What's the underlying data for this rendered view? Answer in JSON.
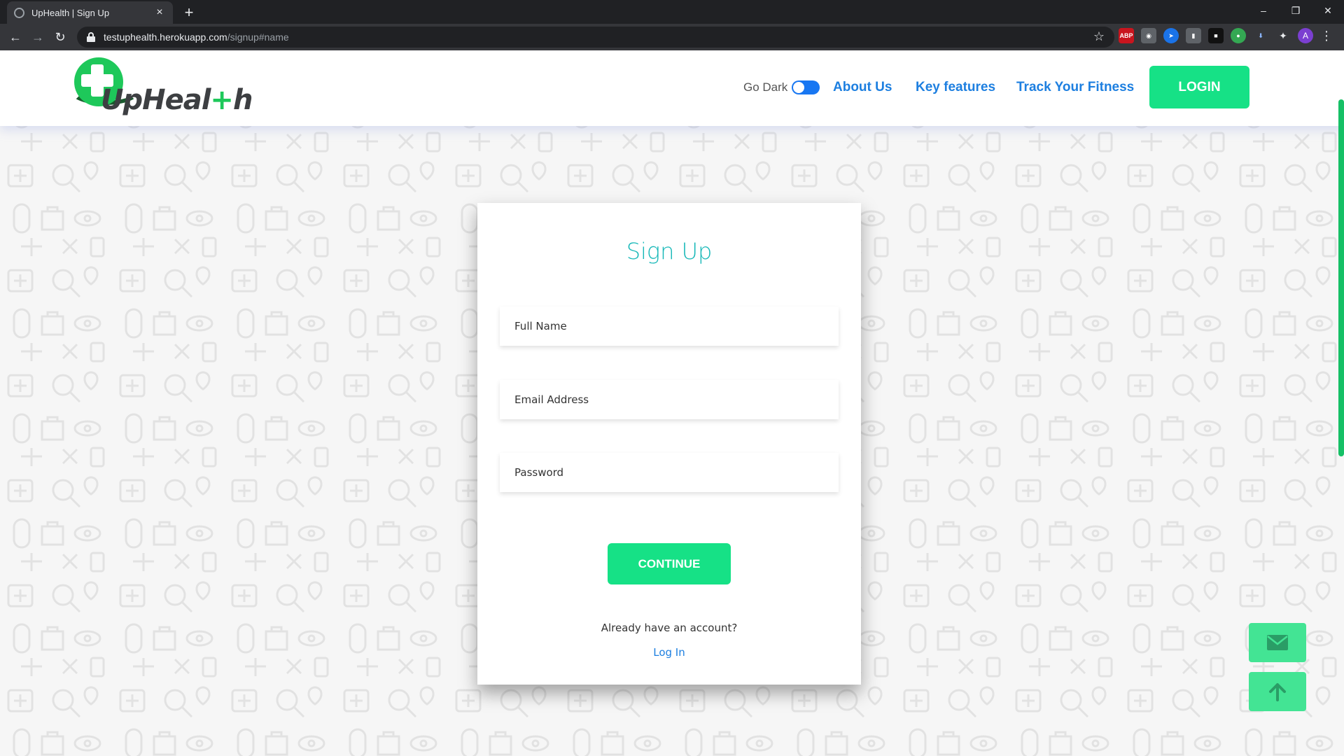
{
  "browser": {
    "tab_title": "UpHealth | Sign Up",
    "tab_close": "×",
    "new_tab": "+",
    "url_host": "testuphealth.herokuapp.com",
    "url_path": "/signup#name",
    "avatar_letter": "A",
    "ext_abp": "ABP",
    "window_minimize": "–",
    "window_restore": "❐",
    "window_close": "✕"
  },
  "nav": {
    "go_dark_label": "Go Dark",
    "links": [
      "About Us",
      "Key features",
      "Track Your Fitness"
    ],
    "login_label": "LOGIN"
  },
  "logo": {
    "text_part1": "UpHeal",
    "text_green": "+",
    "text_part2": "h"
  },
  "signup": {
    "title": "Sign Up",
    "full_name_placeholder": "Full Name",
    "email_placeholder": "Email Address",
    "password_placeholder": "Password",
    "continue_label": "CONTINUE",
    "have_account_text": "Already have an account?",
    "login_link": "Log In"
  },
  "colors": {
    "accent_green": "#16e186",
    "link_blue": "#1d7fe0",
    "title_teal": "#17b8b8"
  }
}
